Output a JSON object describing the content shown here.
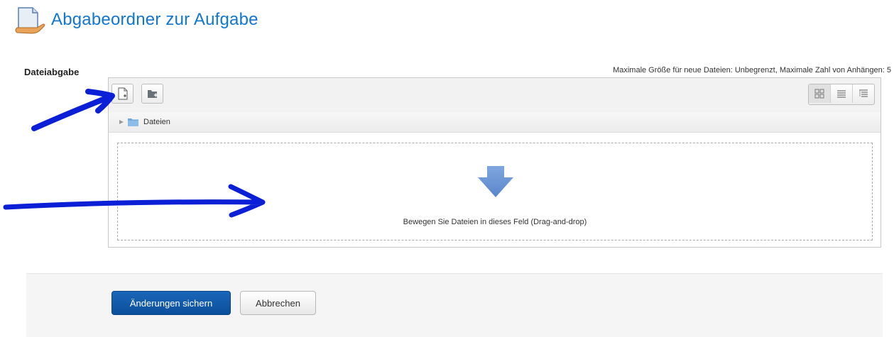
{
  "page": {
    "title": "Abgabeordner zur Aufgabe"
  },
  "form": {
    "field_label": "Dateiabgabe",
    "limits_info": "Maximale Größe für neue Dateien: Unbegrenzt, Maximale Zahl von Anhängen: 5"
  },
  "filemanager": {
    "toolbar": {
      "add_file_icon": "file-add-icon",
      "create_folder_icon": "folder-add-icon",
      "view_modes": [
        "grid-view-icon",
        "list-view-icon",
        "tree-view-icon"
      ]
    },
    "path": {
      "folder_name": "Dateien"
    },
    "dropzone": {
      "text": "Bewegen Sie Dateien in dieses Feld (Drag-and-drop)",
      "icon": "down-arrow-icon"
    }
  },
  "buttons": {
    "save_label": "Änderungen sichern",
    "cancel_label": "Abbrechen"
  },
  "colors": {
    "title": "#1177d1",
    "primary_button": "#0f5aa8",
    "annotation_ink": "#0b1fd6",
    "dropzone_arrow": "#6a95d4"
  }
}
